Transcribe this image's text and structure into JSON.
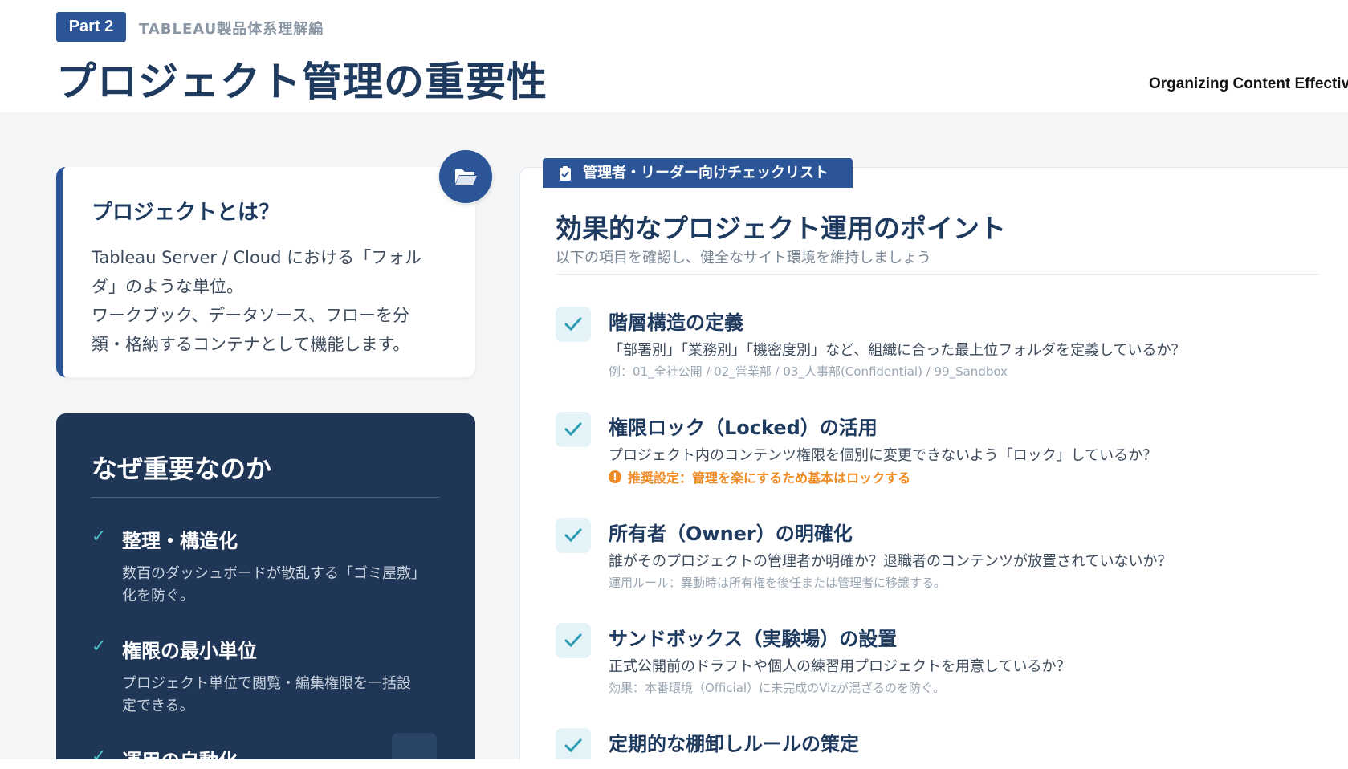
{
  "header": {
    "part_label": "Part 2",
    "section": "TABLEAU製品体系理解編",
    "title": "プロジェクト管理の重要性",
    "subtitle_en": "Organizing Content Effectivel"
  },
  "what_card": {
    "title": "プロジェクトとは？",
    "lines": [
      "Tableau Server / Cloud における「フォル",
      "ダ」のような単位。",
      "ワークブック、データソース、フローを分",
      "類・格納するコンテナとして機能します。"
    ],
    "icon": "folder-open-icon"
  },
  "why_card": {
    "title": "なぜ重要なのか",
    "items": [
      {
        "title": "整理・構造化",
        "text": [
          "数百のダッシュボードが散乱する「ゴミ屋敷」",
          "化を防ぐ。"
        ]
      },
      {
        "title": "権限の最小単位",
        "text": [
          "プロジェクト単位で閲覧・編集権限を一括設",
          "定できる。"
        ]
      },
      {
        "title": "運用の自動化",
        "text": [
          "",
          ""
        ]
      }
    ]
  },
  "checklist": {
    "tab_label": "管理者・リーダー向けチェックリスト",
    "title": "効果的なプロジェクト運用のポイント",
    "description": "以下の項目を確認し、健全なサイト環境を維持しましょう",
    "items": [
      {
        "title": "階層構造の定義",
        "text": "「部署別」「業務別」「機密度別」など、組織に合った最上位フォルダを定義しているか？",
        "note": "例：01_全社公開 / 02_営業部 / 03_人事部(Confidential) / 99_Sandbox"
      },
      {
        "title": "権限ロック（Locked）の活用",
        "text": "プロジェクト内のコンテンツ権限を個別に変更できないよう「ロック」しているか？",
        "warn": "推奨設定：管理を楽にするため基本はロックする"
      },
      {
        "title": "所有者（Owner）の明確化",
        "text": "誰がそのプロジェクトの管理者か明確か？退職者のコンテンツが放置されていないか？",
        "note": "運用ルール：異動時は所有権を後任または管理者に移譲する。"
      },
      {
        "title": "サンドボックス（実験場）の設置",
        "text": "正式公開前のドラフトや個人の練習用プロジェクトを用意しているか？",
        "note": "効果：本番環境（Official）に未完成のVizが混ざるのを防ぐ。"
      },
      {
        "title": "定期的な棚卸しルールの策定",
        "text": "",
        "note": ""
      }
    ]
  },
  "colors": {
    "navy": "#1e3a5f",
    "accent_blue": "#2b5597",
    "dark_card": "#1f3656",
    "teal_check": "#2a9bb0",
    "warn_orange": "#f08a24"
  }
}
